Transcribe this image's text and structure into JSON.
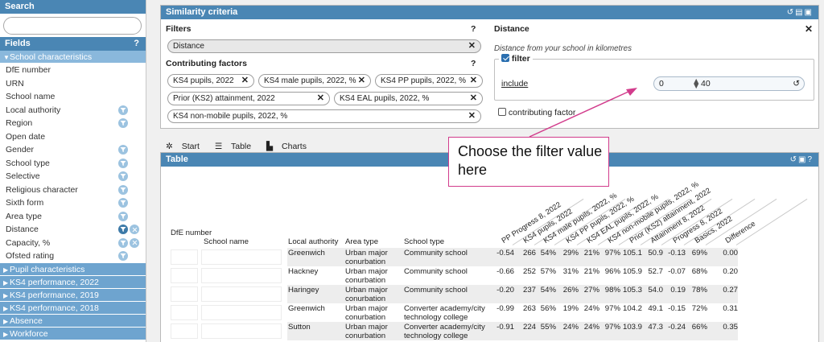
{
  "sidebar": {
    "search_title": "Search",
    "search_placeholder": "",
    "fields_title": "Fields",
    "fields_help": "?",
    "open_group": "School characteristics",
    "fields": [
      {
        "label": "DfE number",
        "icons": 0
      },
      {
        "label": "URN",
        "icons": 0
      },
      {
        "label": "School name",
        "icons": 0
      },
      {
        "label": "Local authority",
        "icons": 1
      },
      {
        "label": "Region",
        "icons": 1
      },
      {
        "label": "Open date",
        "icons": 0
      },
      {
        "label": "Gender",
        "icons": 1
      },
      {
        "label": "School type",
        "icons": 1
      },
      {
        "label": "Selective",
        "icons": 1
      },
      {
        "label": "Religious character",
        "icons": 1
      },
      {
        "label": "Sixth form",
        "icons": 1
      },
      {
        "label": "Area type",
        "icons": 1
      },
      {
        "label": "Distance",
        "icons": 2
      },
      {
        "label": "Capacity, %",
        "icons": 2
      },
      {
        "label": "Ofsted rating",
        "icons": 1
      }
    ],
    "groups": [
      "Pupil characteristics",
      "KS4 performance, 2022",
      "KS4 performance, 2019",
      "KS4 performance, 2018",
      "Absence",
      "Workforce"
    ]
  },
  "criteria": {
    "title": "Similarity criteria",
    "filters_label": "Filters",
    "help": "?",
    "filter_pill": "Distance",
    "factors_label": "Contributing factors",
    "factors": [
      "KS4 pupils, 2022",
      "KS4 male pupils, 2022, %",
      "KS4 PP pupils, 2022, %",
      "Prior (KS2) attainment, 2022",
      "KS4 EAL pupils, 2022, %",
      "KS4 non-mobile pupils, 2022, %"
    ],
    "distance_title": "Distance",
    "distance_close": "✕",
    "distance_desc": "Distance from your school in kilometres",
    "filter_label": "filter",
    "include_label": "include",
    "range_min": "0",
    "range_max": "40",
    "contributing_label": "contributing factor"
  },
  "toolbar": {
    "start": "Start",
    "table": "Table",
    "charts": "Charts"
  },
  "table": {
    "title": "Table",
    "headers": {
      "dfe": "DfE number",
      "school_name": "School name",
      "la": "Local authority",
      "area": "Area type",
      "type": "School type"
    },
    "diag_headers": [
      "PP Progress 8, 2022",
      "KS4 pupils, 2022",
      "KS4 male pupils, 2022, %",
      "KS4 PP pupils, 2022, %",
      "KS4 EAL pupils, 2022, %",
      "KS4 non-mobile pupils, 2022, %",
      "Prior (KS2) attainment, 2022",
      "Attainment 8, 2022",
      "Progress 8, 2022",
      "Basics, 2022",
      "Difference"
    ],
    "rows": [
      {
        "la": "Greenwich",
        "area": "Urban major conurbation",
        "type": "Community school",
        "vals": [
          "-0.54",
          "266",
          "54%",
          "29%",
          "21%",
          "97%",
          "105.1",
          "50.9",
          "-0.13",
          "69%",
          "0.00"
        ]
      },
      {
        "la": "Hackney",
        "area": "Urban major conurbation",
        "type": "Community school",
        "vals": [
          "-0.66",
          "252",
          "57%",
          "31%",
          "21%",
          "96%",
          "105.9",
          "52.7",
          "-0.07",
          "68%",
          "0.20"
        ]
      },
      {
        "la": "Haringey",
        "area": "Urban major conurbation",
        "type": "Community school",
        "vals": [
          "-0.20",
          "237",
          "54%",
          "26%",
          "27%",
          "98%",
          "105.3",
          "54.0",
          "0.19",
          "78%",
          "0.27"
        ]
      },
      {
        "la": "Greenwich",
        "area": "Urban major conurbation",
        "type": "Converter academy/city technology college",
        "vals": [
          "-0.99",
          "263",
          "56%",
          "19%",
          "24%",
          "97%",
          "104.2",
          "49.1",
          "-0.15",
          "72%",
          "0.31"
        ]
      },
      {
        "la": "Sutton",
        "area": "Urban major conurbation",
        "type": "Converter academy/city technology college",
        "vals": [
          "-0.91",
          "224",
          "55%",
          "24%",
          "24%",
          "97%",
          "103.9",
          "47.3",
          "-0.24",
          "66%",
          "0.35"
        ]
      }
    ]
  },
  "callout": {
    "text": "Choose the filter value here"
  },
  "colors": {
    "header_blue": "#4a86b4",
    "accent_pink": "#d23c8c"
  }
}
